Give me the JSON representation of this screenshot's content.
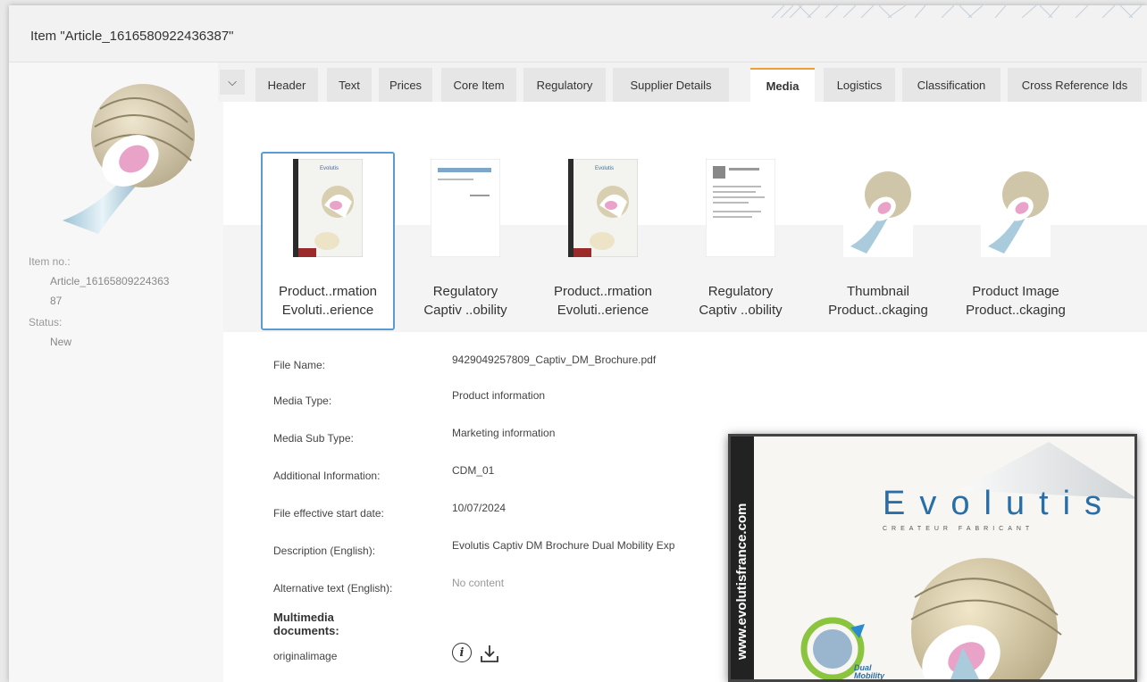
{
  "window": {
    "title": "Item \"Article_1616580922436387\""
  },
  "left_panel": {
    "item_no_label": "Item no.:",
    "item_no_value": "Article_16165809224363",
    "item_no_value_2": "87",
    "status_label": "Status:",
    "status_value": "New"
  },
  "tabs": [
    {
      "label": "Header"
    },
    {
      "label": "Text"
    },
    {
      "label": "Prices"
    },
    {
      "label": "Core Item"
    },
    {
      "label": "Regulatory"
    },
    {
      "label": "Supplier Details"
    },
    {
      "label": "Media",
      "active": true
    },
    {
      "label": "Logistics"
    },
    {
      "label": "Classification"
    },
    {
      "label": "Cross Reference Ids"
    }
  ],
  "media": [
    {
      "line1": "Product..rmation",
      "line2": "Evoluti..erience",
      "kind": "brochure"
    },
    {
      "line1": "Regulatory",
      "line2": "Captiv ..obility",
      "kind": "document"
    },
    {
      "line1": "Product..rmation",
      "line2": "Evoluti..erience",
      "kind": "brochure"
    },
    {
      "line1": "Regulatory",
      "line2": "Captiv ..obility",
      "kind": "document"
    },
    {
      "line1": "Thumbnail",
      "line2": "Product..ckaging",
      "kind": "implant"
    },
    {
      "line1": "Product Image",
      "line2": "Product..ckaging",
      "kind": "implant"
    }
  ],
  "details": [
    {
      "label": "File Name:",
      "value": "9429049257809_Captiv_DM_Brochure.pdf"
    },
    {
      "label": "Media Type:",
      "value": "Product information"
    },
    {
      "label": "Media Sub Type:",
      "value": "Marketing information"
    },
    {
      "label": "Additional Information:",
      "value": "CDM_01"
    },
    {
      "label": "File effective start date:",
      "value": "10/07/2024"
    },
    {
      "label": "Description (English):",
      "value": "Evolutis Captiv DM Brochure Dual Mobility Exp"
    },
    {
      "label": "Alternative text (English):",
      "value": "No content",
      "muted": true
    }
  ],
  "multimedia": {
    "heading": "Multimedia documents:",
    "item_label": "originalimage"
  },
  "preview": {
    "spine_text": "www.evolutisfrance.com",
    "brand": "Evolutis",
    "brand_sub": "CREATEUR FABRICANT",
    "badge_text": "Dual\nMobility"
  }
}
